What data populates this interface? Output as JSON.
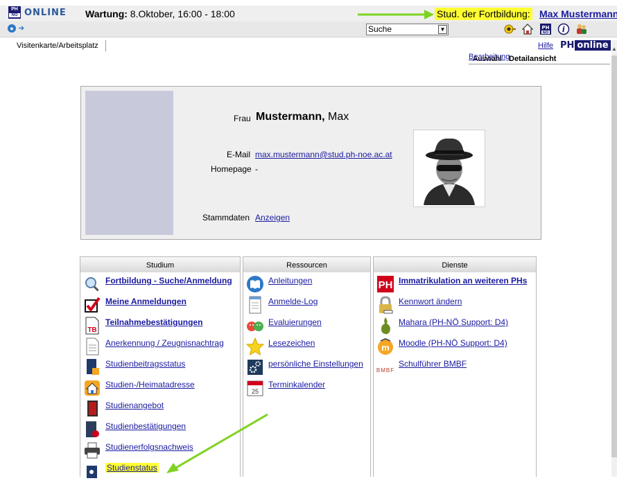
{
  "header": {
    "logo_text": "ONLINE",
    "logo_badge_top": "PH",
    "logo_badge_bottom": "NÖ",
    "maintenance_label": "Wartung:",
    "maintenance_value": " 8.Oktober, 16:00 - 18:00",
    "role": "Stud. der Fortbildung:",
    "user": "Max Mustermann"
  },
  "toolbar": {
    "search_value": "Suche",
    "icons": [
      "key-icon",
      "home-icon",
      "ph-icon",
      "info-icon",
      "people-icon"
    ]
  },
  "tabs": {
    "card_tab": "Visitenkarte/Arbeitsplatz",
    "help": "Hilfe",
    "brand_ph": "PH",
    "brand_online": "online"
  },
  "views": {
    "auswahl": "Auswahl",
    "detail": "Detailansicht",
    "edit": "Bearbeitung"
  },
  "card": {
    "salutation": "Frau",
    "last_name": "Mustermann,",
    "first_name": " Max",
    "email_label": "E-Mail",
    "email": "max.mustermann@stud.ph-noe.ac.at",
    "homepage_label": "Homepage",
    "homepage": "-",
    "stammdaten_label": "Stammdaten",
    "stammdaten_link": "Anzeigen"
  },
  "columns": {
    "studium": {
      "title": "Studium",
      "items": [
        {
          "label": "Fortbildung - Suche/Anmeldung",
          "bold": true
        },
        {
          "label": "Meine Anmeldungen",
          "bold": true
        },
        {
          "label": "Teilnahmebestätigungen",
          "bold": true
        },
        {
          "label": "Anerkennung / Zeugnisnachtrag",
          "bold": false
        },
        {
          "label": "Studienbeitragsstatus",
          "bold": false
        },
        {
          "label": "Studien-/Heimatadresse",
          "bold": false
        },
        {
          "label": "Studienangebot",
          "bold": false
        },
        {
          "label": "Studienbestätigungen",
          "bold": false
        },
        {
          "label": "Studienerfolgsnachweis",
          "bold": false
        },
        {
          "label": "Studienstatus",
          "bold": false
        }
      ]
    },
    "ressourcen": {
      "title": "Ressourcen",
      "items": [
        {
          "label": "Anleitungen"
        },
        {
          "label": "Anmelde-Log"
        },
        {
          "label": "Evaluierungen"
        },
        {
          "label": "Lesezeichen"
        },
        {
          "label": "persönliche Einstellungen"
        },
        {
          "label": "Terminkalender"
        }
      ],
      "calendar_day": "25"
    },
    "dienste": {
      "title": "Dienste",
      "items": [
        {
          "label": "Immatrikulation an weiteren PHs",
          "bold": true
        },
        {
          "label": "Kennwort ändern",
          "bold": false
        },
        {
          "label": "Mahara (PH-NÖ Support: D4)",
          "bold": false
        },
        {
          "label": "Moodle (PH-NÖ Support: D4)",
          "bold": false
        },
        {
          "label": "Schulführer BMBF",
          "bold": false
        }
      ],
      "bmbf_icon_text": "BMBF"
    }
  },
  "colors": {
    "highlight": "#ffff33",
    "link": "#1a1aa0",
    "arrow": "#7ed321",
    "brand": "#1a1a6e"
  }
}
